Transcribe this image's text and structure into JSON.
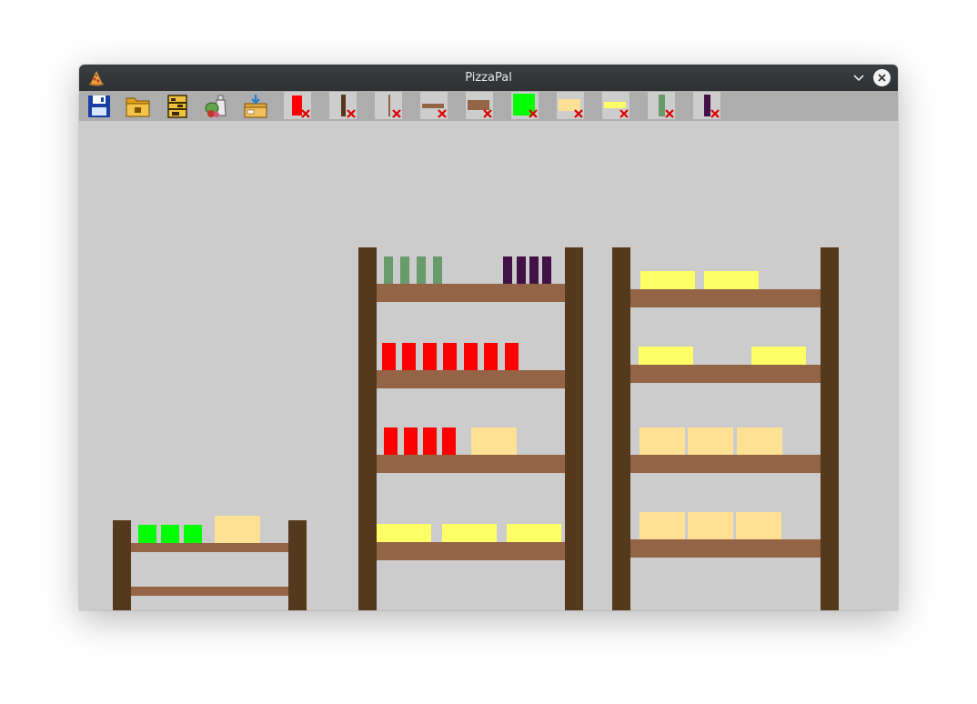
{
  "window": {
    "title": "PizzaPal",
    "app_icon": "pizza-slice-icon"
  },
  "toolbar": {
    "file_buttons": [
      {
        "name": "save-button",
        "icon": "floppy-disk-icon"
      },
      {
        "name": "open-button",
        "icon": "folder-icon"
      },
      {
        "name": "shelf-button",
        "icon": "shelf-unit-icon"
      },
      {
        "name": "ingredients-button",
        "icon": "ingredients-icon"
      },
      {
        "name": "import-button",
        "icon": "box-download-icon"
      }
    ],
    "item_tools": [
      {
        "name": "tomato-sauce-tool",
        "color": "#ff0000",
        "shape": "tall"
      },
      {
        "name": "dark-post-tool",
        "color": "#55391d",
        "shape": "post"
      },
      {
        "name": "thin-post-tool",
        "color": "#946446",
        "shape": "thin"
      },
      {
        "name": "long-plank-tool",
        "color": "#946446",
        "shape": "plank"
      },
      {
        "name": "short-plank-tool",
        "color": "#946446",
        "shape": "block"
      },
      {
        "name": "green-pepper-tool",
        "color": "#00ff00",
        "shape": "square"
      },
      {
        "name": "dough-tool",
        "color": "#ffe195",
        "shape": "wide"
      },
      {
        "name": "cheese-tool",
        "color": "#ffff66",
        "shape": "flat"
      },
      {
        "name": "basil-tool",
        "color": "#699a69",
        "shape": "slim"
      },
      {
        "name": "olive-tool",
        "color": "#421246",
        "shape": "slim"
      }
    ]
  },
  "colors": {
    "background": "#cccccc",
    "post": "#55391d",
    "plank": "#946446",
    "tomato": "#ff0000",
    "pepper": "#00ff00",
    "dough": "#ffe195",
    "cheese": "#ffff66",
    "basil": "#699a69",
    "olive": "#421246"
  }
}
